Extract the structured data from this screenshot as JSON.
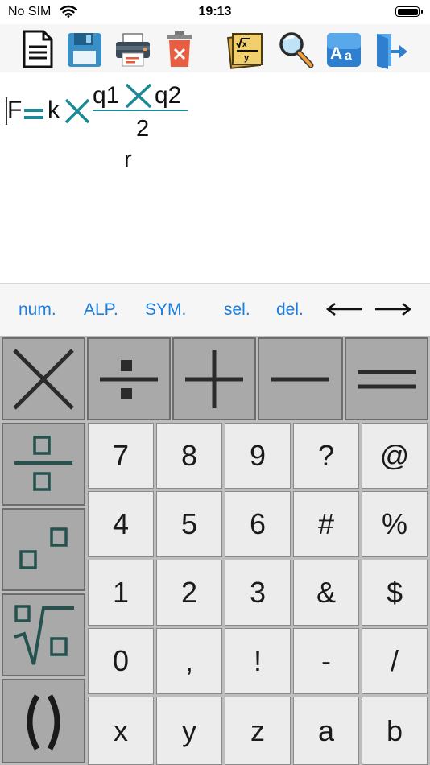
{
  "status_bar": {
    "carrier": "No SIM",
    "time": "19:13"
  },
  "toolbar": {
    "icons": [
      "new-document-icon",
      "save-icon",
      "print-icon",
      "delete-icon",
      "formula-note-icon",
      "search-icon",
      "font-icon",
      "exit-icon"
    ]
  },
  "editor": {
    "lhs": "F",
    "equals": "=",
    "coef": "k",
    "num_left": "q1",
    "num_right": "q2",
    "exponent": "2",
    "denominator": "r",
    "accent_color": "#1b8a97"
  },
  "modes": {
    "num": "num.",
    "alp": "ALP.",
    "sym": "SYM.",
    "sel": "sel.",
    "del": "del."
  },
  "keys": {
    "row1": [
      "7",
      "8",
      "9",
      "?",
      "@"
    ],
    "row2": [
      "4",
      "5",
      "6",
      "#",
      "%"
    ],
    "row3": [
      "1",
      "2",
      "3",
      "&",
      "$"
    ],
    "row4": [
      "0",
      ",",
      "!",
      "-",
      "/"
    ],
    "row5": [
      "x",
      "y",
      "z",
      "a",
      "b"
    ]
  }
}
